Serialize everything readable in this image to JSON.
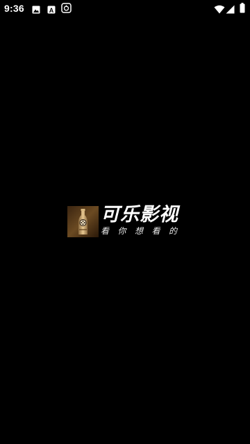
{
  "status_bar": {
    "time": "9:36",
    "left_icons": [
      "image-icon",
      "font-a-icon",
      "shield-icon"
    ],
    "right_icons": [
      "wifi-icon",
      "signal-icon",
      "battery-icon"
    ]
  },
  "splash": {
    "app_name": "可乐影视",
    "slogan": "看你想看的",
    "logo_icon": "cola-bottle-film-reel-icon"
  },
  "colors": {
    "background": "#000000",
    "logo_brown": "#6b4a22",
    "logo_gold": "#c99a5a"
  }
}
